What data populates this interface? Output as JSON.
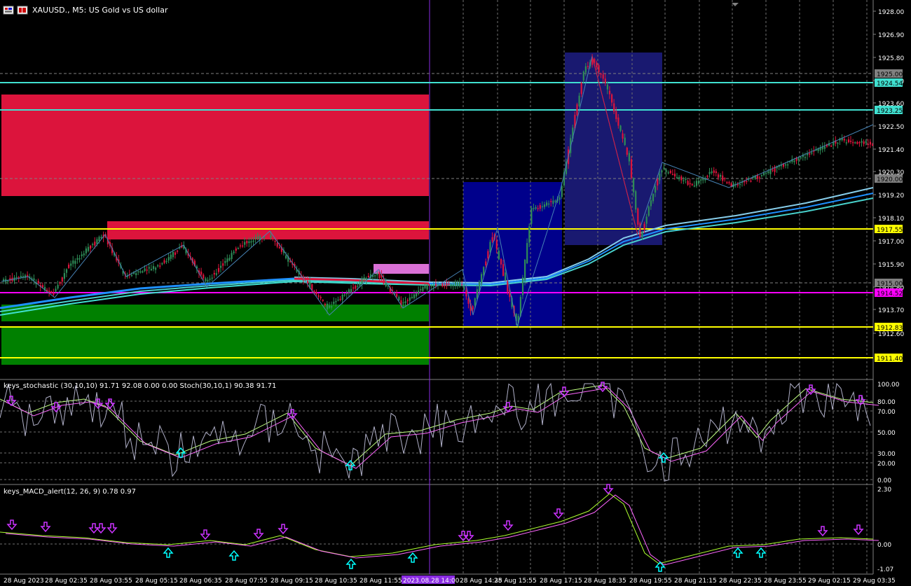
{
  "chart": {
    "symbol_title": "XAUUSD., M5: US Gold vs US dollar",
    "window_icon": "chart-window-icon",
    "colors": {
      "background": "#000000",
      "bull_candle": "#2e8b57",
      "bear_candle": "#dc143c",
      "grid": "#808080",
      "support_zone": "#008000",
      "resistance_zone": "#dc143c",
      "blue_box": "#00008b",
      "level_cyan": "#40e0d0",
      "level_yellow": "#ffff00",
      "level_magenta": "#ff00ff",
      "ma_blue": "#1e90ff",
      "stoch_main": "#c0c0c0",
      "stoch_signal": "#ff00ff",
      "macd_line": "#adff2f",
      "signal_line": "#ff66ff",
      "arrow_down": "#cc33ff",
      "arrow_up": "#00ffff"
    }
  },
  "price_axis": {
    "ticks": [
      "1928.00",
      "1926.90",
      "1925.80",
      "1924.70",
      "1923.60",
      "1922.50",
      "1921.40",
      "1920.30",
      "1919.20",
      "1918.10",
      "1917.00",
      "1915.90",
      "1914.80",
      "1913.70",
      "1912.60"
    ],
    "labels": [
      {
        "text": "1925.00",
        "kind": "current"
      },
      {
        "text": "1924.54",
        "kind": "cyan"
      },
      {
        "text": "1923.25",
        "kind": "cyan"
      },
      {
        "text": "1920.00",
        "kind": "current"
      },
      {
        "text": "1917.55",
        "kind": "yellow"
      },
      {
        "text": "1915.00",
        "kind": "current"
      },
      {
        "text": "1914.52",
        "kind": "magenta"
      },
      {
        "text": "1912.83",
        "kind": "yellow"
      },
      {
        "text": "1911.40",
        "kind": "yellow"
      }
    ]
  },
  "stoch_panel": {
    "title": "keys_stochastic (30,10,10) 91.71 92.08 0.00 0.00 Stoch(30,10,1) 90.38 91.71",
    "levels": [
      "100.00",
      "80.00",
      "70.00",
      "50.00",
      "30.00",
      "20.00",
      "0.00"
    ]
  },
  "macd_panel": {
    "title": "keys_MACD_alert(12, 26, 9) 0.78 0.97",
    "levels": [
      "2.30",
      "0.00",
      "-1.07"
    ]
  },
  "time_axis": {
    "labels": [
      "28 Aug 2023",
      "28 Aug 02:35",
      "28 Aug 03:55",
      "28 Aug 05:15",
      "28 Aug 06:35",
      "28 Aug 07:55",
      "28 Aug 09:15",
      "28 Aug 10:35",
      "28 Aug 11:55",
      "2023.08.28 14:00",
      "28 Aug 14:35",
      "28 Aug 15:55",
      "28 Aug 17:15",
      "28 Aug 18:35",
      "28 Aug 19:55",
      "28 Aug 21:15",
      "28 Aug 22:35",
      "28 Aug 23:55",
      "29 Aug 02:15",
      "29 Aug 03:35"
    ]
  }
}
